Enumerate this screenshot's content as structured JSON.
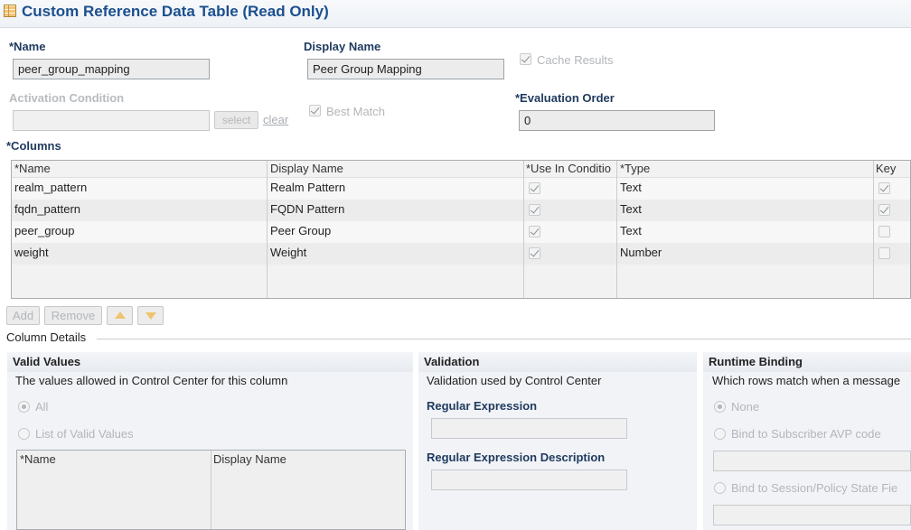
{
  "header": {
    "title": "Custom Reference Data Table (Read Only)",
    "icon": "table-icon"
  },
  "form": {
    "name": {
      "label": "*Name",
      "value": "peer_group_mapping"
    },
    "display_name": {
      "label": "Display Name",
      "value": "Peer Group Mapping"
    },
    "cache_results": {
      "label": "Cache Results",
      "checked": true
    },
    "activation_condition": {
      "label": "Activation Condition",
      "value": "",
      "select_label": "select",
      "clear_label": "clear"
    },
    "best_match": {
      "label": "Best Match",
      "checked": true
    },
    "evaluation_order": {
      "label": "*Evaluation Order",
      "value": "0"
    }
  },
  "columns": {
    "label": "*Columns",
    "headers": [
      "*Name",
      "Display Name",
      "*Use In Conditio",
      "*Type",
      "Key"
    ],
    "rows": [
      {
        "name": "realm_pattern",
        "display": "Realm Pattern",
        "use_in_condition": true,
        "type": "Text",
        "key": true
      },
      {
        "name": "fqdn_pattern",
        "display": "FQDN Pattern",
        "use_in_condition": true,
        "type": "Text",
        "key": true
      },
      {
        "name": "peer_group",
        "display": "Peer Group",
        "use_in_condition": true,
        "type": "Text",
        "key": false
      },
      {
        "name": "weight",
        "display": "Weight",
        "use_in_condition": true,
        "type": "Number",
        "key": false
      }
    ],
    "buttons": {
      "add": "Add",
      "remove": "Remove"
    }
  },
  "column_details": {
    "title": "Column Details",
    "valid_values": {
      "title": "Valid Values",
      "description": "The values allowed in Control Center for this column",
      "option_all": "All",
      "option_list": "List of Valid Values",
      "table_headers": [
        "*Name",
        "Display Name"
      ]
    },
    "validation": {
      "title": "Validation",
      "description": "Validation used by Control Center",
      "regex_label": "Regular Expression",
      "regex_desc_label": "Regular Expression Description"
    },
    "runtime_binding": {
      "title": "Runtime Binding",
      "description": "Which rows match when a message",
      "option_none": "None",
      "option_avp": "Bind to Subscriber AVP code",
      "option_session": "Bind to Session/Policy State Fie"
    }
  }
}
